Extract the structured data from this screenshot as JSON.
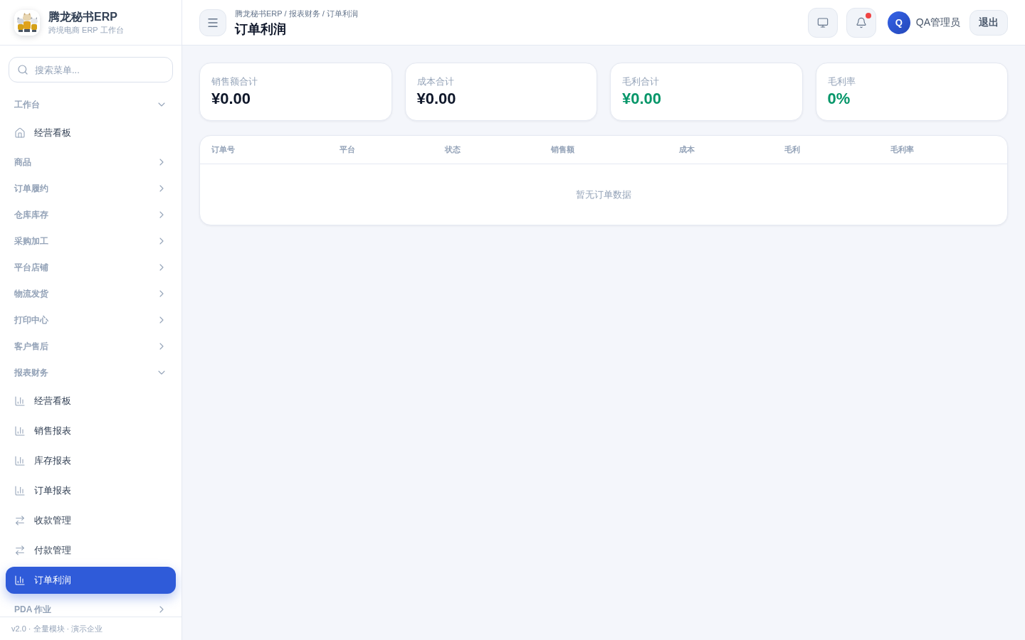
{
  "sidebar": {
    "brand": {
      "title": "腾龙秘书ERP",
      "subtitle": "跨境电商 ERP 工作台"
    },
    "search": {
      "placeholder": "搜索菜单..."
    },
    "groups": [
      {
        "label": "工作台",
        "expanded": true,
        "children": [
          {
            "label": "经营看板",
            "kind": "home",
            "selected": false
          }
        ]
      },
      {
        "label": "商品",
        "expanded": false
      },
      {
        "label": "订单履约",
        "expanded": false
      },
      {
        "label": "仓库库存",
        "expanded": false
      },
      {
        "label": "采购加工",
        "expanded": false
      },
      {
        "label": "平台店铺",
        "expanded": false
      },
      {
        "label": "物流发货",
        "expanded": false
      },
      {
        "label": "打印中心",
        "expanded": false
      },
      {
        "label": "客户售后",
        "expanded": false
      },
      {
        "label": "报表财务",
        "expanded": true,
        "children": [
          {
            "label": "经营看板",
            "kind": "chart",
            "selected": false
          },
          {
            "label": "销售报表",
            "kind": "chart",
            "selected": false
          },
          {
            "label": "库存报表",
            "kind": "chart",
            "selected": false
          },
          {
            "label": "订单报表",
            "kind": "chart",
            "selected": false
          },
          {
            "label": "收款管理",
            "kind": "exchange",
            "selected": false
          },
          {
            "label": "付款管理",
            "kind": "exchange",
            "selected": false
          },
          {
            "label": "订单利润",
            "kind": "chart",
            "selected": true
          }
        ]
      },
      {
        "label": "PDA 作业",
        "expanded": false
      }
    ],
    "footer": "v2.0 · 全量模块 · 演示企业"
  },
  "header": {
    "breadcrumb": "腾龙秘书ERP / 报表财务 / 订单利润",
    "title": "订单利润",
    "notifications": {
      "unread": true
    },
    "user": {
      "initial": "Q",
      "name": "QA管理员"
    },
    "logout": "退出"
  },
  "stats": [
    {
      "label": "销售额合计",
      "value": "¥0.00",
      "color": "#0f172a"
    },
    {
      "label": "成本合计",
      "value": "¥0.00",
      "color": "#0f172a"
    },
    {
      "label": "毛利合计",
      "value": "¥0.00",
      "color": "#059669"
    },
    {
      "label": "毛利率",
      "value": "0%",
      "color": "#059669"
    }
  ],
  "table": {
    "columns": [
      "订单号",
      "平台",
      "状态",
      "销售额",
      "成本",
      "毛利",
      "毛利率"
    ],
    "empty_text": "暂无订单数据"
  }
}
